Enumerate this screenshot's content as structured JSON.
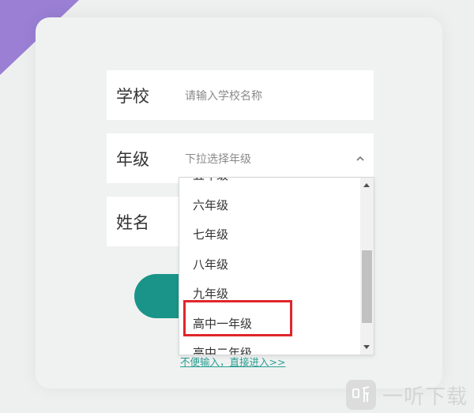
{
  "form": {
    "school": {
      "label": "学校",
      "placeholder": "请输入学校名称"
    },
    "grade": {
      "label": "年级",
      "placeholder": "下拉选择年级"
    },
    "name": {
      "label": "姓名"
    },
    "skip_link": "不便输入，直接进入>>"
  },
  "grade_dropdown": {
    "options": [
      "五年级",
      "六年级",
      "七年级",
      "八年级",
      "九年级",
      "高中一年级",
      "高中二年级"
    ],
    "highlighted": "高中一年级"
  },
  "watermark": {
    "text": "一听下载"
  },
  "colors": {
    "accent": "#1a9488",
    "highlight_border": "#e0262b",
    "corner": "#9a7fd4",
    "link": "#2a9e94"
  }
}
